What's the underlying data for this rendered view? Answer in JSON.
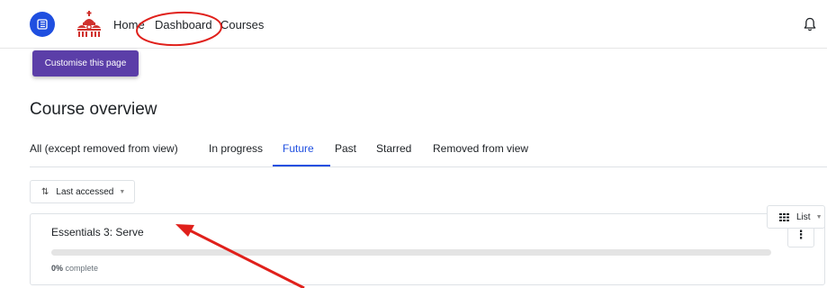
{
  "nav": {
    "links": [
      "Home",
      "Dashboard",
      "Courses"
    ]
  },
  "customise_label": "Customise this page",
  "page_title": "Course overview",
  "tabs": [
    {
      "label": "All (except removed from view)",
      "active": false
    },
    {
      "label": "In progress",
      "active": false
    },
    {
      "label": "Future",
      "active": true
    },
    {
      "label": "Past",
      "active": false
    },
    {
      "label": "Starred",
      "active": false
    },
    {
      "label": "Removed from view",
      "active": false
    }
  ],
  "sort": {
    "label": "Last accessed"
  },
  "view": {
    "label": "List"
  },
  "course": {
    "name": "Essentials 3: Serve",
    "progress_percent": "0%",
    "progress_suffix": " complete",
    "progress_value": 0
  },
  "colors": {
    "primary": "#1f4fe0",
    "customise_button": "#5b3ea8",
    "annotation": "#e0201b",
    "logo": "#d0312d"
  },
  "icons": {
    "drawer": "drawer-toggle-icon",
    "logo": "cathedral-logo-icon",
    "bell": "bell-icon",
    "sort": "sort-ascending-icon",
    "view": "grid-icon",
    "menu": "vertical-dots-icon"
  }
}
